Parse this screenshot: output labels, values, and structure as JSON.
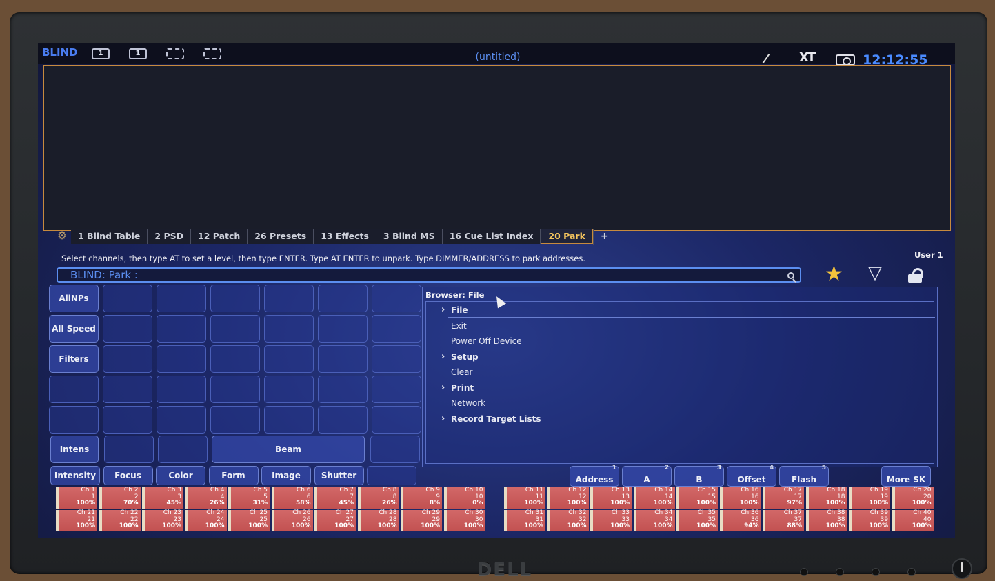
{
  "topbar": {
    "mode": "BLIND",
    "monitor_icons": [
      "1",
      "1",
      "",
      ""
    ],
    "window_title": "(untitled)",
    "logo": "XT",
    "clock": "12:12:55 AM"
  },
  "tabs": [
    {
      "label": "1 Blind Table"
    },
    {
      "label": "2 PSD"
    },
    {
      "label": "12 Patch"
    },
    {
      "label": "26 Presets"
    },
    {
      "label": "13 Effects"
    },
    {
      "label": "3 Blind MS"
    },
    {
      "label": "16 Cue List Index"
    },
    {
      "label": "20 Park"
    }
  ],
  "tab_add": "+",
  "prompt": "Select channels, then type AT to set a level, then type ENTER.  Type AT ENTER to unpark.  Type DIMMER/ADDRESS to park addresses.",
  "user": "User 1",
  "command_line": "BLIND: Park :",
  "grid": {
    "side_buttons": [
      "AllNPs",
      "All Speed",
      "Filters"
    ],
    "row6": {
      "intens": "Intens",
      "beam": "Beam"
    },
    "categories": [
      "Intensity",
      "Focus",
      "Color",
      "Form",
      "Image",
      "Shutter"
    ]
  },
  "browser": {
    "title": "Browser: File",
    "items": [
      {
        "label": "File",
        "folder": true
      },
      {
        "label": "Exit",
        "folder": false
      },
      {
        "label": "Power Off Device",
        "folder": false
      },
      {
        "label": "Setup",
        "folder": true
      },
      {
        "label": "Clear",
        "folder": false
      },
      {
        "label": "Print",
        "folder": true
      },
      {
        "label": "Network",
        "folder": false
      },
      {
        "label": "Record Target Lists",
        "folder": true
      }
    ]
  },
  "softkeys": [
    {
      "label": "Address",
      "num": "1"
    },
    {
      "label": "A",
      "num": "2"
    },
    {
      "label": "B",
      "num": "3"
    },
    {
      "label": "Offset",
      "num": "4"
    },
    {
      "label": "Flash",
      "num": "5"
    },
    {
      "label": "More SK",
      "num": ""
    }
  ],
  "channels": [
    {
      "name": "Ch 1",
      "addr": "1",
      "level": "100%"
    },
    {
      "name": "Ch 2",
      "addr": "2",
      "level": "70%"
    },
    {
      "name": "Ch 3",
      "addr": "3",
      "level": "45%"
    },
    {
      "name": "Ch 4",
      "addr": "4",
      "level": "26%"
    },
    {
      "name": "Ch 5",
      "addr": "5",
      "level": "31%"
    },
    {
      "name": "Ch 6",
      "addr": "6",
      "level": "58%"
    },
    {
      "name": "Ch 7",
      "addr": "7",
      "level": "45%"
    },
    {
      "name": "Ch 8",
      "addr": "8",
      "level": "26%"
    },
    {
      "name": "Ch 9",
      "addr": "9",
      "level": "8%"
    },
    {
      "name": "Ch 10",
      "addr": "10",
      "level": "0%"
    },
    {
      "name": "Ch 11",
      "addr": "11",
      "level": "100%"
    },
    {
      "name": "Ch 12",
      "addr": "12",
      "level": "100%"
    },
    {
      "name": "Ch 13",
      "addr": "13",
      "level": "100%"
    },
    {
      "name": "Ch 14",
      "addr": "14",
      "level": "100%"
    },
    {
      "name": "Ch 15",
      "addr": "15",
      "level": "100%"
    },
    {
      "name": "Ch 16",
      "addr": "16",
      "level": "100%"
    },
    {
      "name": "Ch 17",
      "addr": "17",
      "level": "97%"
    },
    {
      "name": "Ch 18",
      "addr": "18",
      "level": "100%"
    },
    {
      "name": "Ch 19",
      "addr": "19",
      "level": "100%"
    },
    {
      "name": "Ch 20",
      "addr": "20",
      "level": "100%"
    },
    {
      "name": "Ch 21",
      "addr": "21",
      "level": "100%"
    },
    {
      "name": "Ch 22",
      "addr": "22",
      "level": "100%"
    },
    {
      "name": "Ch 23",
      "addr": "23",
      "level": "100%"
    },
    {
      "name": "Ch 24",
      "addr": "24",
      "level": "100%"
    },
    {
      "name": "Ch 25",
      "addr": "25",
      "level": "100%"
    },
    {
      "name": "Ch 26",
      "addr": "26",
      "level": "100%"
    },
    {
      "name": "Ch 27",
      "addr": "27",
      "level": "100%"
    },
    {
      "name": "Ch 28",
      "addr": "28",
      "level": "100%"
    },
    {
      "name": "Ch 29",
      "addr": "29",
      "level": "100%"
    },
    {
      "name": "Ch 30",
      "addr": "30",
      "level": "100%"
    },
    {
      "name": "Ch 31",
      "addr": "31",
      "level": "100%"
    },
    {
      "name": "Ch 32",
      "addr": "32",
      "level": "100%"
    },
    {
      "name": "Ch 33",
      "addr": "33",
      "level": "100%"
    },
    {
      "name": "Ch 34",
      "addr": "34",
      "level": "100%"
    },
    {
      "name": "Ch 35",
      "addr": "35",
      "level": "100%"
    },
    {
      "name": "Ch 36",
      "addr": "36",
      "level": "94%"
    },
    {
      "name": "Ch 37",
      "addr": "37",
      "level": "88%"
    },
    {
      "name": "Ch 38",
      "addr": "38",
      "level": "100%"
    },
    {
      "name": "Ch 39",
      "addr": "39",
      "level": "100%"
    },
    {
      "name": "Ch 40",
      "addr": "40",
      "level": "100%"
    }
  ],
  "bezel": {
    "brand": "DELL"
  }
}
